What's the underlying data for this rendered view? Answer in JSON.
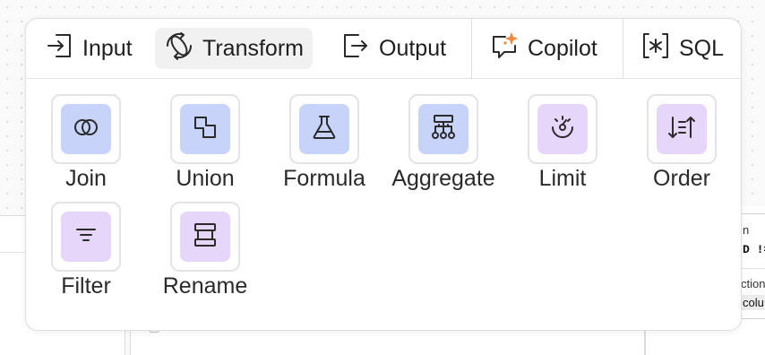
{
  "background": {
    "right_panel": {
      "line1": "n",
      "line2": "D !=",
      "line3": "ction",
      "line4": "colu"
    }
  },
  "colors": {
    "blue_tile": "#c8d3fa",
    "purple_tile": "#e6d6fa",
    "copilot_accent": "#f0883e"
  },
  "tabs": [
    {
      "label": "Input",
      "icon": "input-icon",
      "active": false
    },
    {
      "label": "Transform",
      "icon": "transform-icon",
      "active": true
    },
    {
      "label": "Output",
      "icon": "output-icon",
      "active": false
    },
    {
      "label": "Copilot",
      "icon": "copilot-sparkle-icon",
      "active": false
    },
    {
      "label": "SQL",
      "icon": "sql-icon",
      "active": false
    }
  ],
  "transforms": [
    {
      "label": "Join",
      "icon": "join-icon",
      "tint": "blue"
    },
    {
      "label": "Union",
      "icon": "union-icon",
      "tint": "blue"
    },
    {
      "label": "Formula",
      "icon": "formula-flask-icon",
      "tint": "blue"
    },
    {
      "label": "Aggregate",
      "icon": "aggregate-icon",
      "tint": "blue"
    },
    {
      "label": "Limit",
      "icon": "limit-icon",
      "tint": "purple"
    },
    {
      "label": "Order",
      "icon": "order-icon",
      "tint": "purple"
    },
    {
      "label": "Filter",
      "icon": "filter-icon",
      "tint": "purple"
    },
    {
      "label": "Rename",
      "icon": "rename-icon",
      "tint": "purple"
    }
  ]
}
